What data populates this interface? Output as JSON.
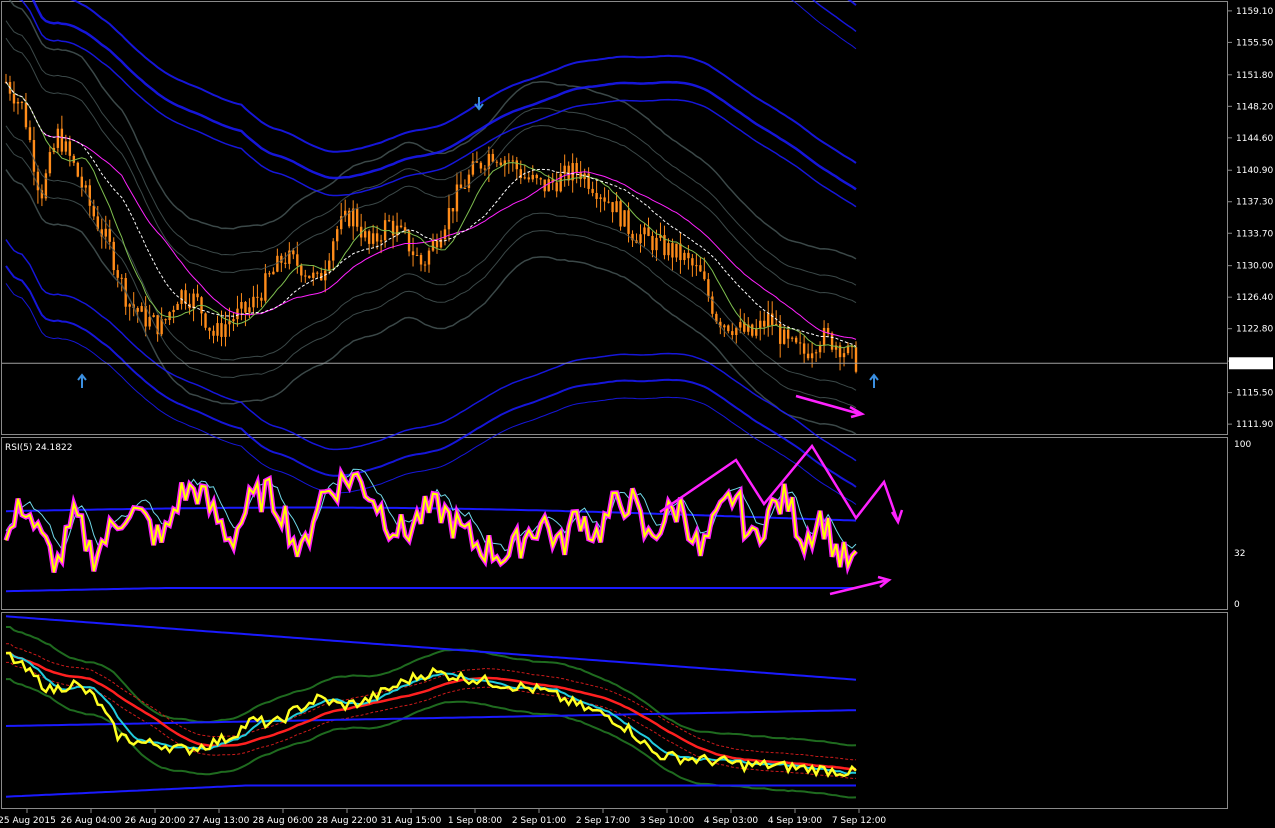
{
  "chart_data": {
    "type": "candlestick",
    "instrument_note": "",
    "main_panel": {
      "price_axis_ticks": [
        "1159.10",
        "1155.50",
        "1151.80",
        "1148.20",
        "1144.60",
        "1140.90",
        "1137.30",
        "1133.70",
        "1130.00",
        "1126.40",
        "1122.80",
        "1119.10",
        "1115.50",
        "1111.90"
      ],
      "price_range": [
        1111.0,
        1160.0
      ],
      "current_price": "1118.85",
      "current_price_value": 1118.85,
      "down_arrow_at": "1 Sep 08:00",
      "up_arrows_at": [
        "26 Aug 04:00",
        "7 Sep 12:00"
      ],
      "close_path": [
        1151,
        1148,
        1138,
        1145,
        1141,
        1136,
        1132,
        1126,
        1124,
        1123,
        1127,
        1126,
        1122,
        1124,
        1125,
        1128,
        1131,
        1130,
        1128,
        1134,
        1136,
        1132,
        1135,
        1133,
        1130,
        1134,
        1138,
        1141,
        1143,
        1142,
        1140,
        1139,
        1140,
        1141,
        1139,
        1137,
        1134,
        1133,
        1132,
        1131,
        1129,
        1124,
        1123,
        1122,
        1124,
        1121,
        1120,
        1122,
        1121,
        1119
      ]
    },
    "rsi_panel": {
      "label": "RSI(5) 24.1822",
      "levels": [
        "100",
        "32",
        "0"
      ],
      "rsi_path": [
        38,
        65,
        40,
        25,
        55,
        30,
        45,
        60,
        52,
        38,
        68,
        72,
        56,
        40,
        62,
        70,
        58,
        28,
        66,
        74,
        80,
        70,
        52,
        44,
        56,
        60,
        48,
        38,
        34,
        30,
        44,
        52,
        35,
        58,
        42,
        60,
        66,
        40,
        54,
        62,
        30,
        52,
        70,
        38,
        58,
        66,
        40,
        55,
        30,
        24
      ]
    },
    "lower_panel": {
      "label": "",
      "main_path": [
        0.82,
        0.72,
        0.62,
        0.66,
        0.58,
        0.38,
        0.34,
        0.33,
        0.3,
        0.33,
        0.37,
        0.46,
        0.44,
        0.52,
        0.58,
        0.54,
        0.56,
        0.62,
        0.68,
        0.72,
        0.7,
        0.68,
        0.66,
        0.64,
        0.62,
        0.57,
        0.52,
        0.48,
        0.4,
        0.28,
        0.26,
        0.25,
        0.24,
        0.22,
        0.22,
        0.21,
        0.2,
        0.19,
        0.18
      ]
    },
    "time_axis": [
      "25 Aug 2015",
      "26 Aug 04:00",
      "26 Aug 20:00",
      "27 Aug 13:00",
      "28 Aug 06:00",
      "28 Aug 22:00",
      "31 Aug 15:00",
      "1 Sep 08:00",
      "2 Sep 01:00",
      "2 Sep 17:00",
      "3 Sep 10:00",
      "4 Sep 03:00",
      "4 Sep 19:00",
      "7 Sep 12:00"
    ],
    "colors": {
      "background": "#000000",
      "bull_candle": "#ff8c1a",
      "bear_candle": "#ff8c1a",
      "band_blue": "#1a1aff",
      "band_gray": "#4a5a5a",
      "magenta": "#ff22ff",
      "rsi_line": "#ffff00",
      "rsi_highlight": "#ff22ff",
      "lower_green": "#1f6b1f",
      "lower_red": "#ff2020",
      "lower_cyan": "#22ccdd",
      "lower_yellow": "#ffff22",
      "panel_border": "#8a8a8a"
    }
  }
}
